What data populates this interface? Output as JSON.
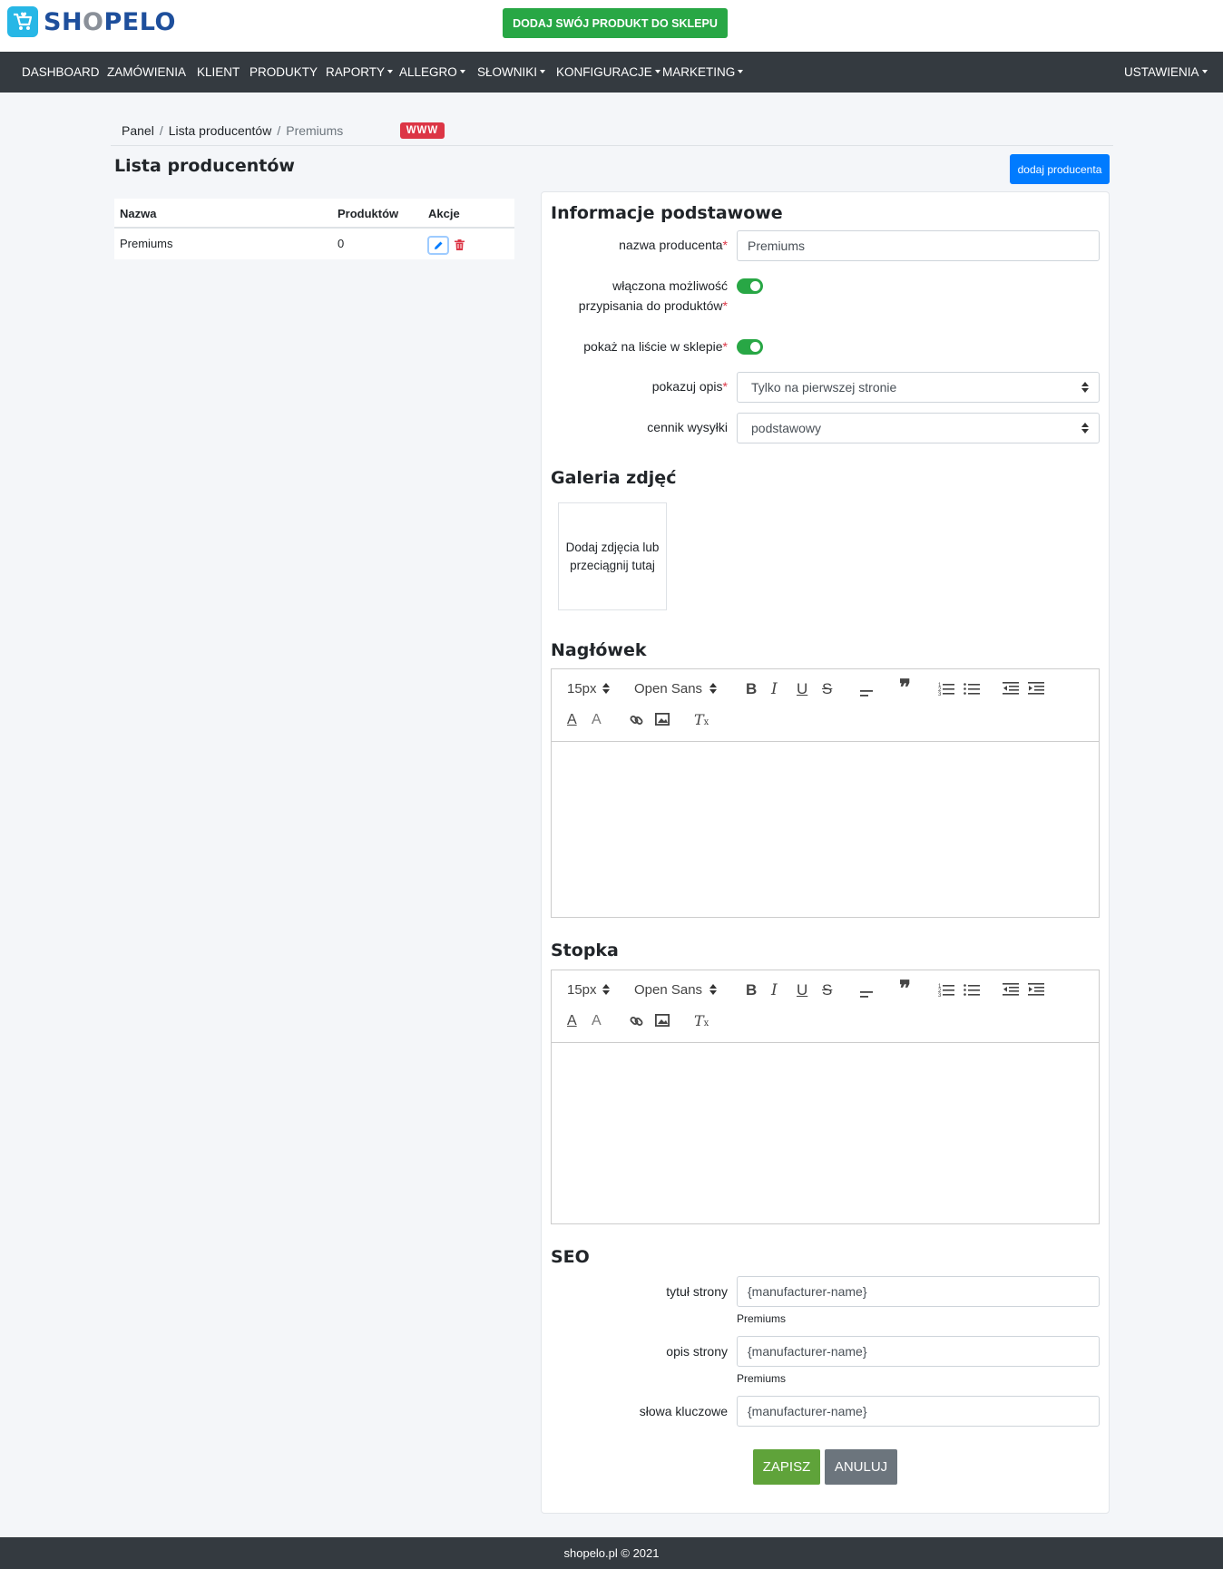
{
  "brand": {
    "name_part1": "SH",
    "name_o": "O",
    "name_part2": "PELO"
  },
  "header": {
    "promo_button": "DODAJ SWÓJ PRODUKT DO SKLEPU"
  },
  "nav": {
    "items": [
      {
        "label": "DASHBOARD",
        "dropdown": false
      },
      {
        "label": "ZAMÓWIENIA",
        "dropdown": false
      },
      {
        "label": "KLIENT",
        "dropdown": false
      },
      {
        "label": "PRODUKTY",
        "dropdown": false
      },
      {
        "label": "RAPORTY",
        "dropdown": true
      },
      {
        "label": "ALLEGRO",
        "dropdown": true
      },
      {
        "label": "SŁOWNIKI",
        "dropdown": true
      },
      {
        "label": "KONFIGURACJE",
        "dropdown": true
      },
      {
        "label": "MARKETING",
        "dropdown": true
      }
    ],
    "settings": "USTAWIENIA"
  },
  "breadcrumb": {
    "items": [
      "Panel",
      "Lista producentów",
      "Premiums"
    ],
    "badge": "WWW"
  },
  "page": {
    "title": "Lista producentów",
    "add_button": "dodaj producenta"
  },
  "table": {
    "columns": [
      "Nazwa",
      "Produktów",
      "Akcje"
    ],
    "rows": [
      {
        "name": "Premiums",
        "products": "0"
      }
    ]
  },
  "form": {
    "basic_title": "Informacje podstawowe",
    "name_label": "nazwa producenta",
    "name_value": "Premiums",
    "assign_label_line1": "włączona możliwość",
    "assign_label_line2": "przypisania do produktów",
    "assign_enabled": true,
    "show_label": "pokaż na liście w sklepie",
    "show_enabled": true,
    "desc_label": "pokazuj opis",
    "desc_value": "Tylko na pierwszej stronie",
    "shipping_label": "cennik wysyłki",
    "shipping_value": "podstawowy",
    "required_mark": "*"
  },
  "gallery": {
    "title": "Galeria zdjęć",
    "dropzone_text": "Dodaj zdjęcia lub przeciągnij tutaj"
  },
  "header_editor": {
    "title": "Nagłówek",
    "font_size": "15px",
    "font_family": "Open Sans"
  },
  "footer_editor": {
    "title": "Stopka",
    "font_size": "15px",
    "font_family": "Open Sans"
  },
  "seo": {
    "title": "SEO",
    "page_title_label": "tytuł strony",
    "page_title_value": "{manufacturer-name}",
    "page_title_help": "Premiums",
    "page_desc_label": "opis strony",
    "page_desc_value": "{manufacturer-name}",
    "page_desc_help": "Premiums",
    "keywords_label": "słowa kluczowe",
    "keywords_value": "{manufacturer-name}"
  },
  "actions": {
    "save": "ZAPISZ",
    "cancel": "ANULUJ"
  },
  "footer": {
    "text": "shopelo.pl © 2021"
  },
  "colors": {
    "primary": "#007bff",
    "success": "#28a745",
    "danger": "#dc3545",
    "nav": "#343a40",
    "save": "#5fa33a"
  }
}
